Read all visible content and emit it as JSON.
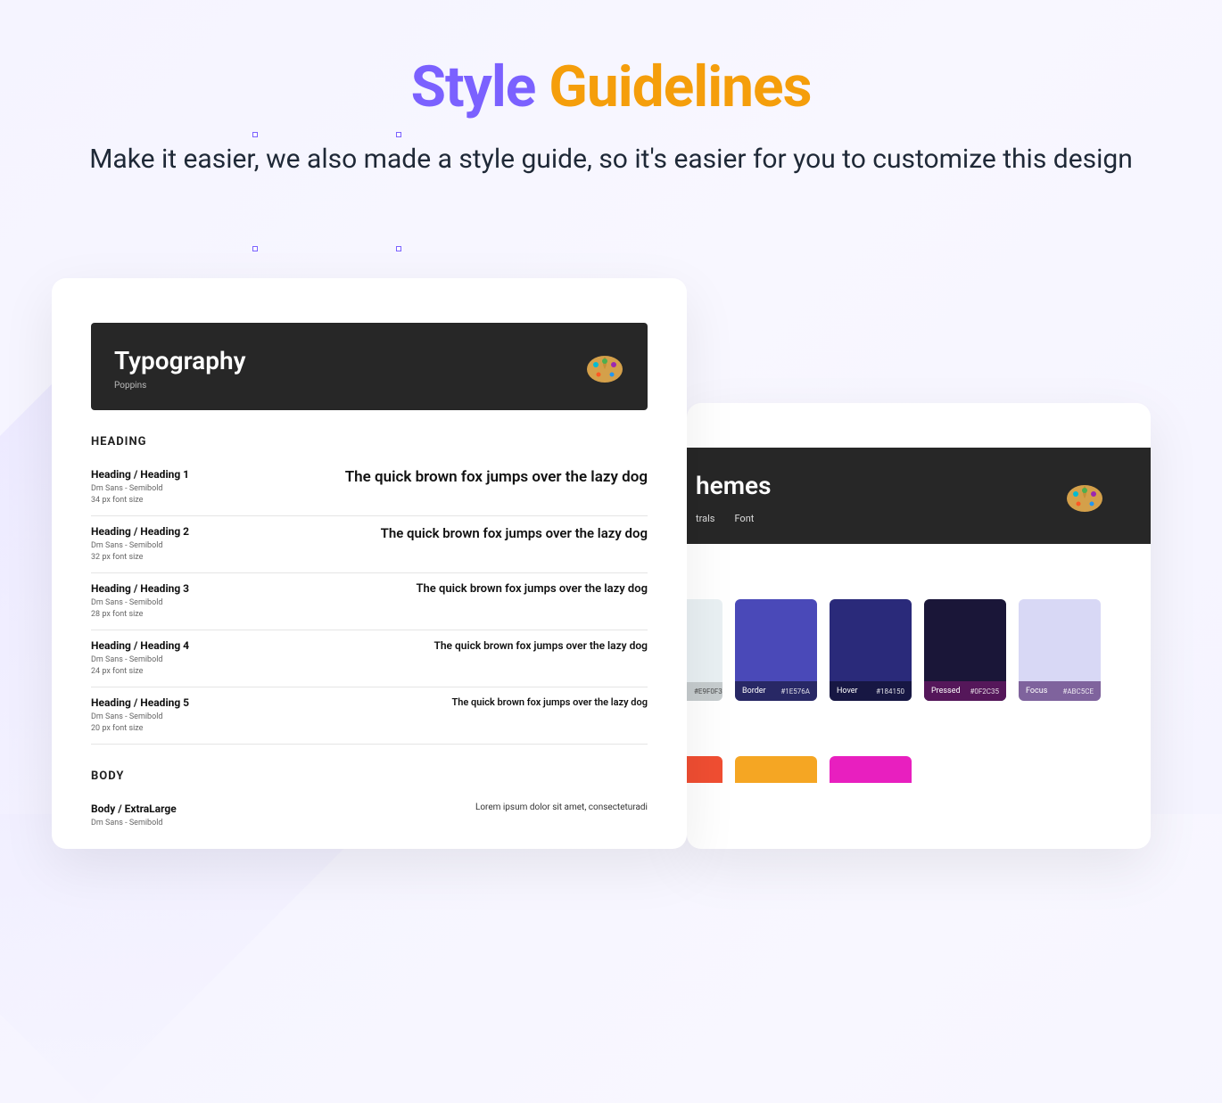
{
  "hero": {
    "title_style": "Style",
    "title_guidelines": "Guidelines",
    "subtitle": "Make  it easier, we also made a style guide, so it's easier for you to customize this design"
  },
  "typography": {
    "header_title": "Typography",
    "header_meta": "Poppins",
    "heading_label": "HEADING",
    "body_label": "BODY",
    "sample": "The quick brown fox jumps over the lazy dog",
    "body_sample": "Lorem ipsum dolor sit amet, consecteturadi",
    "rows": [
      {
        "name": "Heading / Heading 1",
        "font": "Dm Sans - Semibold",
        "size": "34 px font size"
      },
      {
        "name": "Heading / Heading 2",
        "font": "Dm Sans - Semibold",
        "size": "32 px font size"
      },
      {
        "name": "Heading / Heading 3",
        "font": "Dm Sans - Semibold",
        "size": "28 px font size"
      },
      {
        "name": "Heading / Heading 4",
        "font": "Dm Sans - Semibold",
        "size": "24 px font size"
      },
      {
        "name": "Heading / Heading 5",
        "font": "Dm Sans - Semibold",
        "size": "20 px font size"
      }
    ],
    "body_row": {
      "name": "Body / ExtraLarge",
      "font": "Dm Sans - Semibold"
    }
  },
  "colors": {
    "header_title": "hemes",
    "tab1": "trals",
    "tab2": "Font",
    "swatches": [
      {
        "name": "",
        "hex": "#E9F0F3",
        "bg": "#E9F0F3"
      },
      {
        "name": "Border",
        "hex": "#1E576A",
        "bg": "#4a49b8"
      },
      {
        "name": "Hover",
        "hex": "#184150",
        "bg": "#2a2a7a"
      },
      {
        "name": "Pressed",
        "hex": "#0F2C35",
        "bg": "#1a1638"
      },
      {
        "name": "Focus",
        "hex": "#ABC5CE",
        "bg": "#d8d8f5"
      }
    ],
    "row2": [
      {
        "bg": "#f04e32"
      },
      {
        "bg": "#f5a623"
      },
      {
        "bg": "#e81fbf"
      }
    ]
  }
}
